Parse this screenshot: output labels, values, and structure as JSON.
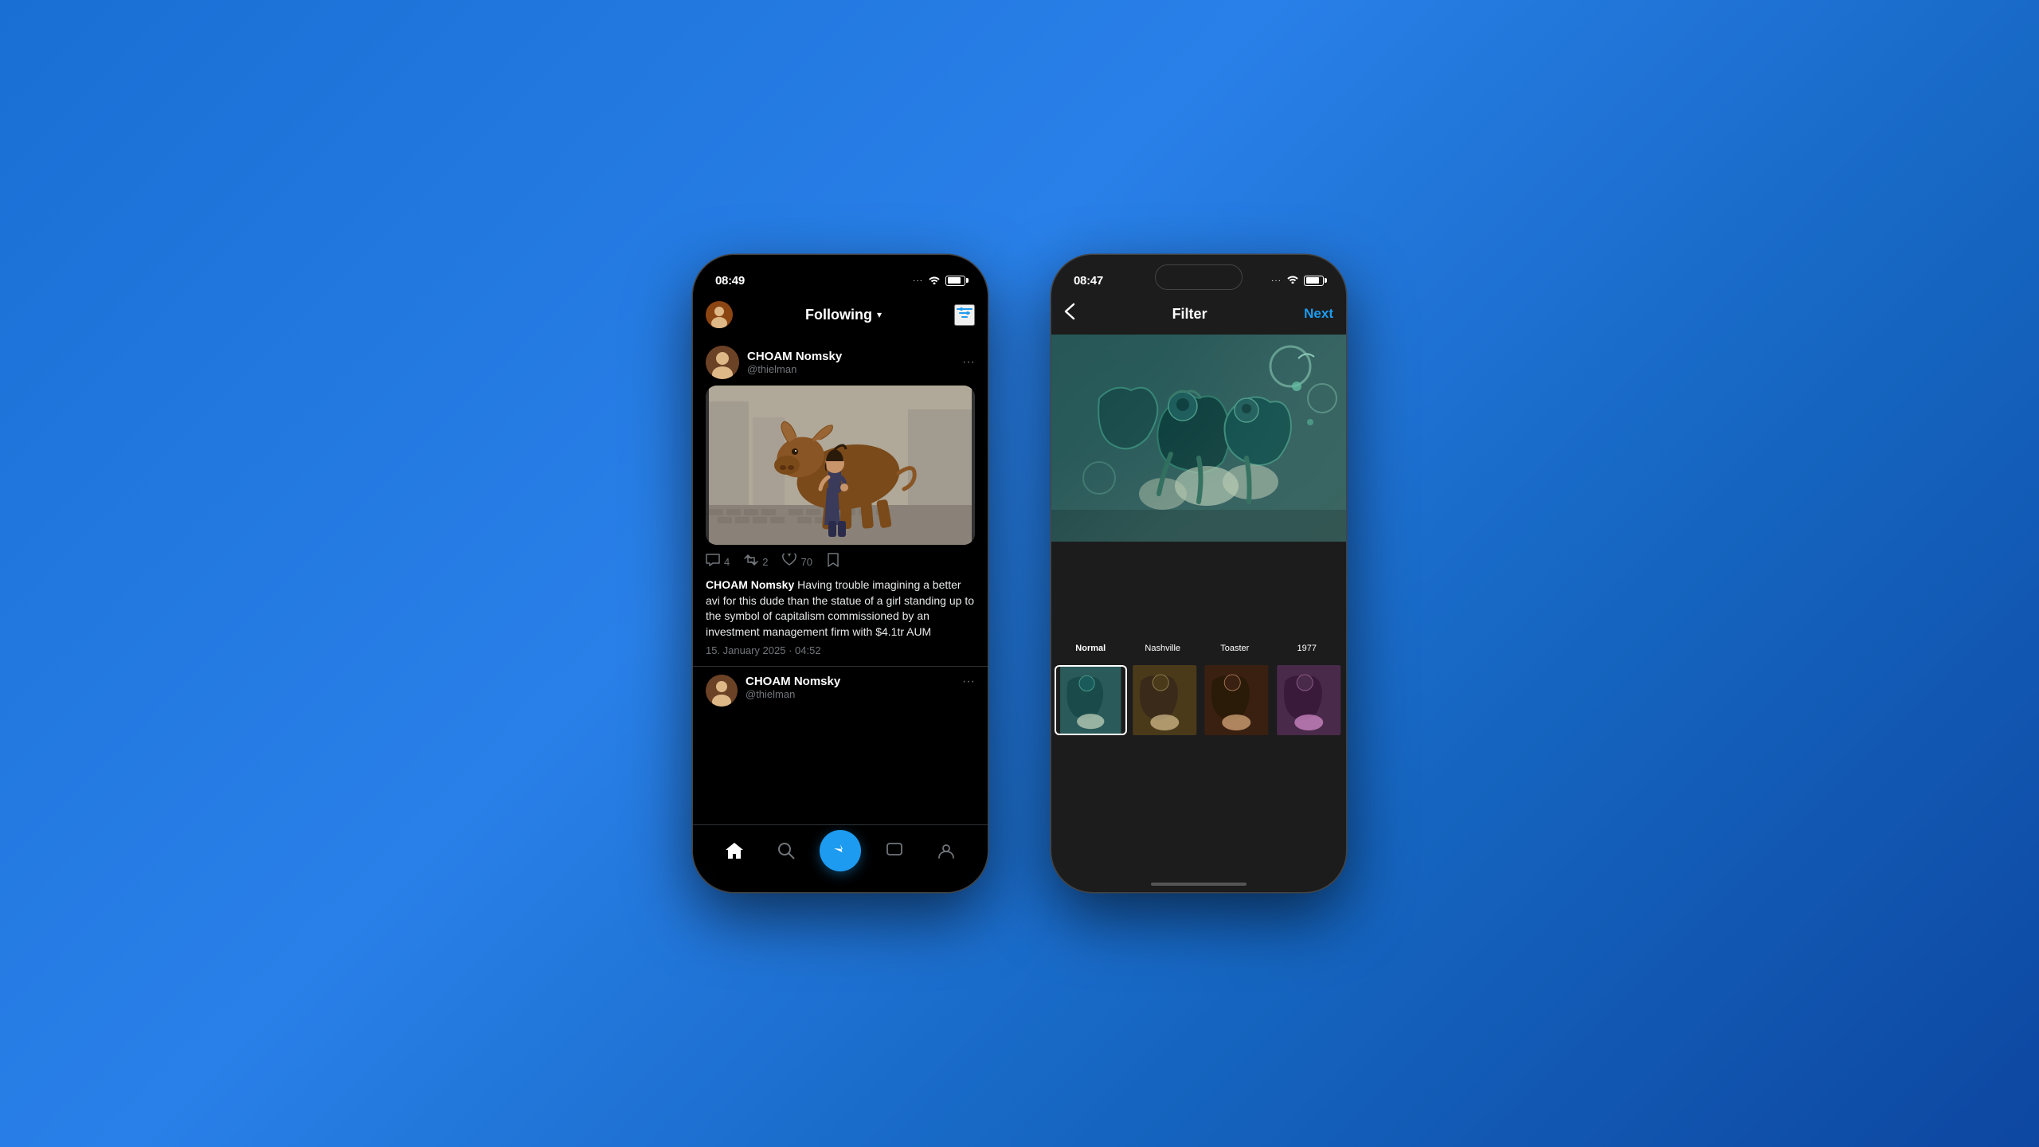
{
  "background": {
    "gradient": "blue radial"
  },
  "phone1": {
    "statusBar": {
      "time": "08:49",
      "dots": "···",
      "wifi": "wifi",
      "battery": "battery"
    },
    "header": {
      "title": "Following",
      "filterIcon": "≡"
    },
    "tweet1": {
      "userName": "CHOAM Nomsky",
      "userHandle": "@thielman",
      "moreIcon": "···",
      "imageAlt": "Charging Bull statue with Fearless Girl",
      "actions": {
        "comments": "4",
        "retweets": "2",
        "likes": "70",
        "bookmark": "bookmark"
      },
      "text": "CHOAM Nomsky Having trouble imagining a better avi for this dude than the statue of a girl standing up to the symbol of capitalism commissioned by an investment management firm with $4.1tr AUM",
      "timestamp": "15. January 2025 · 04:52"
    },
    "tweet2": {
      "userName": "CHOAM Nomsky",
      "userHandle": "@thielman"
    },
    "nav": {
      "home": "⌂",
      "search": "⌕",
      "post": "⚡",
      "notifications": "□",
      "profile": "○"
    }
  },
  "phone2": {
    "statusBar": {
      "time": "08:47",
      "dots": "···",
      "wifi": "wifi",
      "battery": "battery"
    },
    "header": {
      "backLabel": "‹",
      "title": "Filter",
      "nextLabel": "Next"
    },
    "filters": {
      "labels": [
        "Normal",
        "Nashville",
        "Toaster",
        "1977"
      ],
      "active": 0
    },
    "imageAlt": "Stylized filtered cartoon artwork"
  }
}
